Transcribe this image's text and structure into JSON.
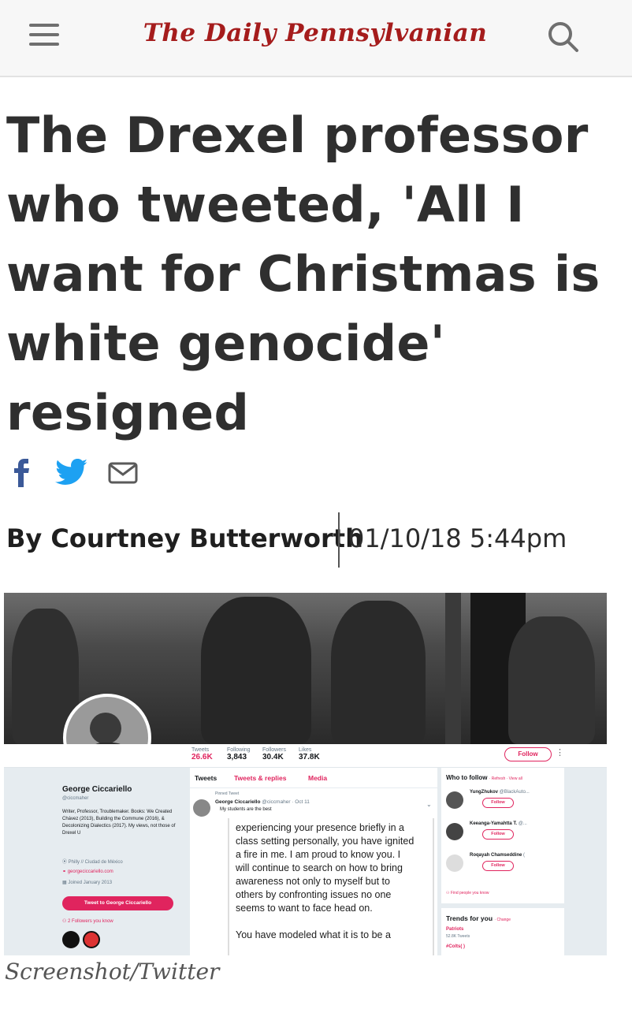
{
  "header": {
    "masthead": "The Daily Pennsylvanian",
    "menu_icon": "hamburger-menu-icon",
    "search_icon": "search-icon",
    "accent_color": "#a51c1c"
  },
  "article": {
    "headline_lines": [
      "The Drexel professor",
      "who tweeted, 'All I",
      "want for Christmas is",
      "white genocide'",
      "resigned"
    ],
    "share_icons": [
      "facebook-icon",
      "twitter-icon",
      "mail-icon"
    ],
    "byline": "By Courtney Butterworth",
    "date": "01/10/18 5:44pm",
    "caption": "Screenshot/Twitter"
  },
  "twitter": {
    "stats": [
      {
        "label": "Tweets",
        "value": "26.6K"
      },
      {
        "label": "Following",
        "value": "3,843"
      },
      {
        "label": "Followers",
        "value": "30.4K"
      },
      {
        "label": "Likes",
        "value": "37.8K"
      }
    ],
    "follow_label": "Follow",
    "profile": {
      "name": "George Ciccariello",
      "handle": "@ciccmaher",
      "bio": "Writer, Professor, Troublemaker. Books: We Created Chávez (2013), Building the Commune (2016), & Decolonizing Dialectics (2017). My views, not those of Drexel U",
      "location": "Philly // Ciudad de México",
      "website": "georgeciccariello.com",
      "joined": "Joined January 2013",
      "tweet_to": "Tweet to George Ciccariello",
      "followers_you_know": "2 Followers you know"
    },
    "tabs": [
      "Tweets",
      "Tweets & replies",
      "Media"
    ],
    "tweet": {
      "pinned": "Pinned Tweet",
      "author": "George Ciccariello",
      "handle_date": "@ciccmaher · Oct 11",
      "subline": "My students are the best",
      "body_lines": [
        "experiencing your presence briefly in a",
        "class setting personally, you have ignited",
        "a fire in me.  I am proud to know you.  I",
        "will continue to search on how to bring",
        "awareness not only to myself but to",
        "others by confronting issues no one",
        "seems to want to face head on.",
        "You have modeled what it is to be a"
      ]
    },
    "who_to_follow": {
      "title": "Who to follow",
      "links": "· Refresh · View all",
      "suggestions": [
        {
          "name": "YungZhukov",
          "handle": "@BlackAuto..."
        },
        {
          "name": "Keeanga-Yamahtta T.",
          "handle": "@..."
        },
        {
          "name": "Roqayah Chamseddine",
          "handle": "("
        }
      ],
      "follow_label": "Follow",
      "find_people": "Find people you know"
    },
    "trends": {
      "title": "Trends for you",
      "change": "· Change",
      "items": [
        {
          "name": "Patriots",
          "count": "52.8K Tweets"
        },
        {
          "name": "#Colts( )",
          "count": ""
        }
      ]
    },
    "brand_pink": "#e0245e"
  }
}
